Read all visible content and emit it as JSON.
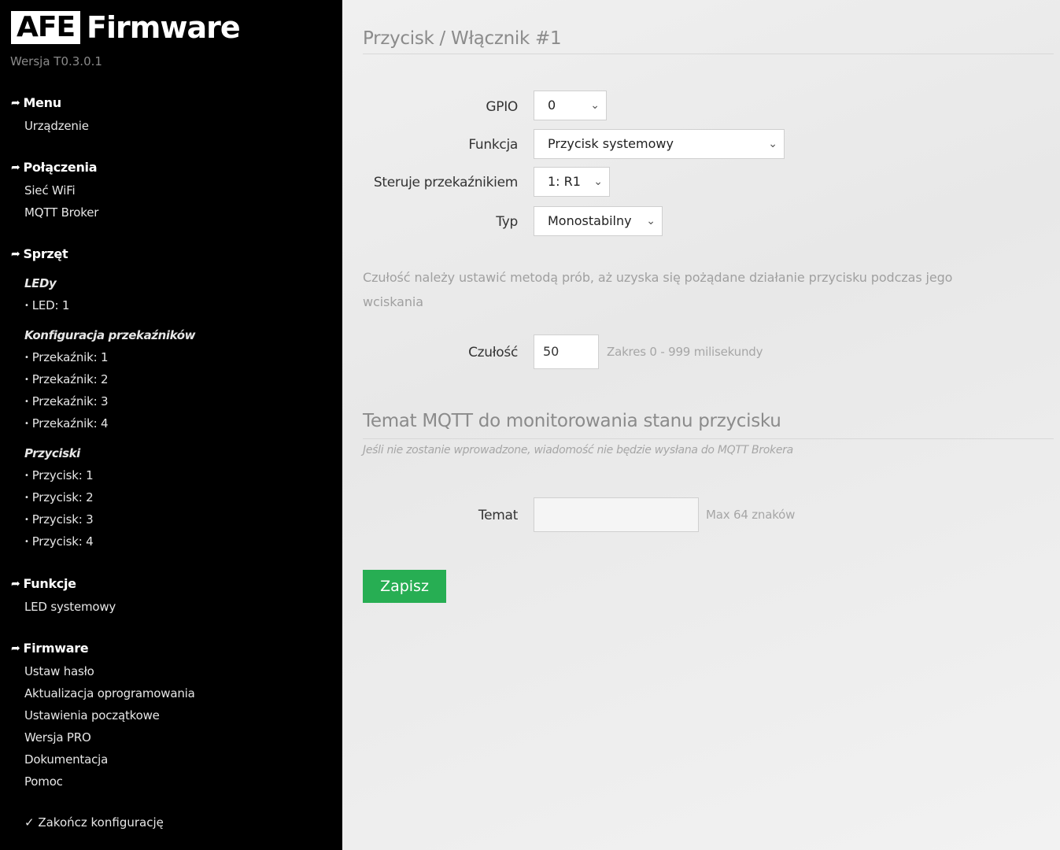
{
  "sidebar": {
    "logo_box": "AFE",
    "logo_text": "Firmware",
    "version": "Wersja T0.3.0.1",
    "menu": {
      "label": "Menu",
      "items": [
        "Urządzenie"
      ]
    },
    "connections": {
      "label": "Połączenia",
      "items": [
        "Sieć WiFi",
        "MQTT Broker"
      ]
    },
    "hardware": {
      "label": "Sprzęt",
      "leds": {
        "label": "LEDy",
        "items": [
          "LED: 1"
        ]
      },
      "relays": {
        "label": "Konfiguracja przekaźników",
        "items": [
          "Przekaźnik: 1",
          "Przekaźnik: 2",
          "Przekaźnik: 3",
          "Przekaźnik: 4"
        ]
      },
      "buttons": {
        "label": "Przyciski",
        "items": [
          "Przycisk: 1",
          "Przycisk: 2",
          "Przycisk: 3",
          "Przycisk: 4"
        ]
      }
    },
    "functions": {
      "label": "Funkcje",
      "items": [
        "LED systemowy"
      ]
    },
    "firmware": {
      "label": "Firmware",
      "items": [
        "Ustaw hasło",
        "Aktualizacja oprogramowania",
        "Ustawienia początkowe",
        "Wersja PRO",
        "Dokumentacja",
        "Pomoc"
      ]
    },
    "finish": "✓ Zakończ konfigurację",
    "arrow_icon": "➦",
    "bullet": "•"
  },
  "main": {
    "title": "Przycisk / Włącznik #1",
    "gpio": {
      "label": "GPIO",
      "value": "0"
    },
    "function": {
      "label": "Funkcja",
      "value": "Przycisk systemowy"
    },
    "relay": {
      "label": "Steruje przekaźnikiem",
      "value": "1: R1"
    },
    "type": {
      "label": "Typ",
      "value": "Monostabilny"
    },
    "sensitivity_note": "Czułość należy ustawić metodą prób, aż uzyska się pożądane działanie przycisku podczas jego wciskania",
    "sensitivity": {
      "label": "Czułość",
      "value": "50",
      "hint": "Zakres 0 - 999 milisekundy"
    },
    "mqtt": {
      "title": "Temat MQTT do monitorowania stanu przycisku",
      "note": "Jeśli nie zostanie wprowadzone, wiadomość nie będzie wysłana do MQTT Brokera",
      "topic_label": "Temat",
      "topic_value": "",
      "topic_hint": "Max 64 znaków"
    },
    "save": "Zapisz",
    "chevron": "⌄"
  },
  "colors": {
    "save_button": "#27ae53",
    "sidebar_bg": "#000000"
  }
}
